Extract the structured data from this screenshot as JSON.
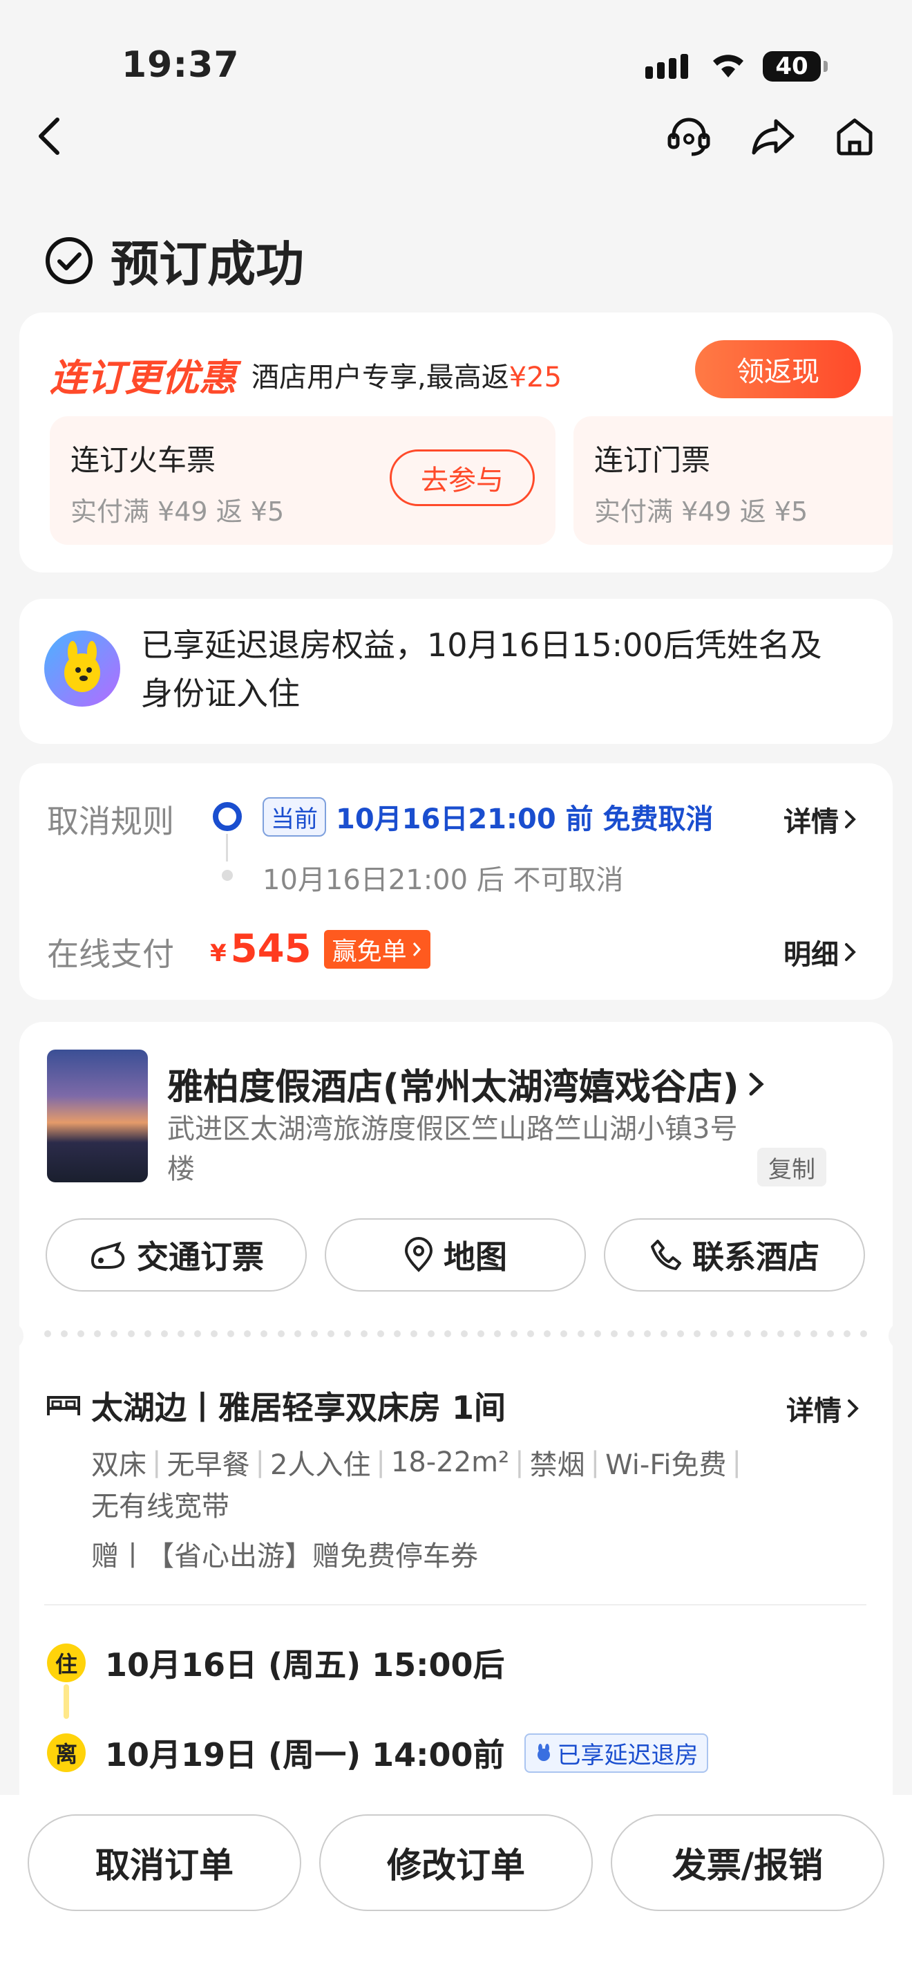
{
  "status_bar": {
    "time": "19:37",
    "battery": "40"
  },
  "page": {
    "title": "预订成功"
  },
  "promo": {
    "title": "连订更优惠",
    "subtitle": "酒店用户专享,最高返",
    "max_cashback": "¥25",
    "cashback_button": "领返现",
    "offers": [
      {
        "title": "连订火车票",
        "desc": "实付满 ¥49 返 ¥5",
        "button": "去参与"
      },
      {
        "title": "连订门票",
        "desc": "实付满 ¥49 返 ¥5"
      }
    ]
  },
  "late_checkout": {
    "text": "已享延迟退房权益，10月16日15:00后凭姓名及身份证入住"
  },
  "cancel": {
    "label": "取消规则",
    "current_tag": "当前",
    "rule_free": "10月16日21:00 前 免费取消",
    "rule_after": "10月16日21:00 后 不可取消",
    "detail": "详情"
  },
  "payment": {
    "label": "在线支付",
    "currency": "¥",
    "amount": "545",
    "free_tag": "赢免单",
    "detail": "明细"
  },
  "hotel": {
    "name": "雅柏度假酒店(常州太湖湾嬉戏谷店)",
    "address": "武进区太湖湾旅游度假区竺山路竺山湖小镇3号楼",
    "copy": "复制",
    "actions": [
      "交通订票",
      "地图",
      "联系酒店"
    ]
  },
  "room": {
    "title": "太湖边丨雅居轻享双床房 1间",
    "detail": "详情",
    "amenities": [
      "双床",
      "无早餐",
      "2人入住",
      "18-22m²",
      "禁烟",
      "Wi-Fi免费"
    ],
    "amenities_line2": "无有线宽带",
    "gift": "赠丨【省心出游】赠免费停车券"
  },
  "stay": {
    "checkin_mark": "住",
    "checkin": "10月16日 (周五) 15:00后",
    "checkout_mark": "离",
    "checkout": "10月19日 (周一) 14:00前",
    "late_tag": "已享延迟退房"
  },
  "bottom": {
    "cancel": "取消订单",
    "modify": "修改订单",
    "invoice": "发票/报销"
  },
  "colors": {
    "accent": "#ff4a2a",
    "blue": "#1a4ecf",
    "yellow": "#ffd30a"
  }
}
